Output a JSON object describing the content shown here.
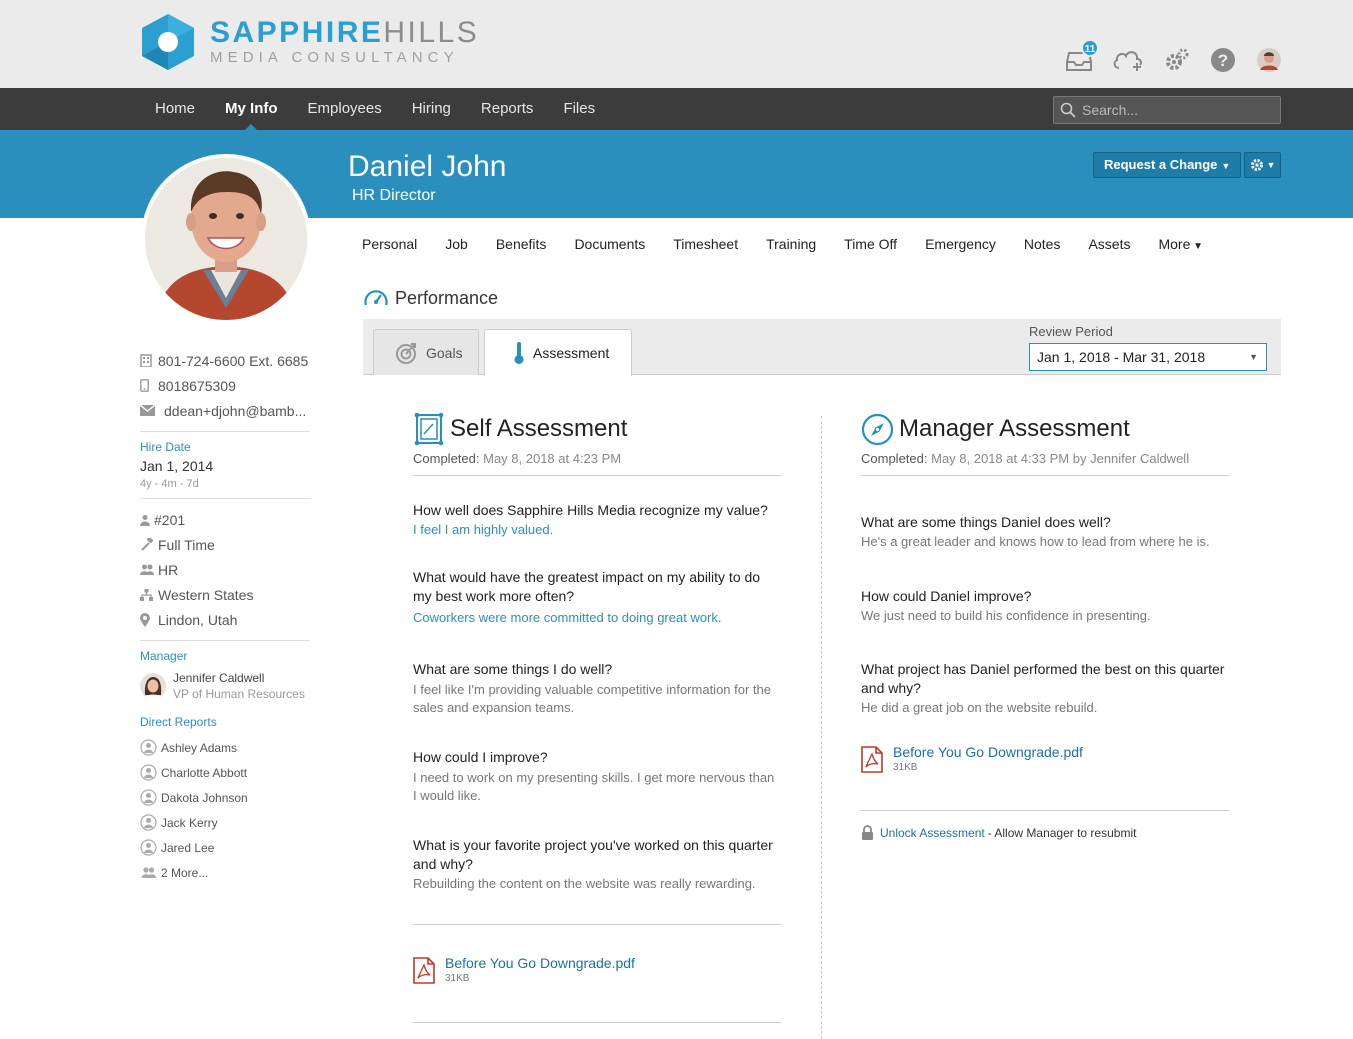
{
  "app": {
    "logo_word_1": "SAPPHIRE",
    "logo_word_2": "HILLS",
    "logo_sub": "MEDIA CONSULTANCY",
    "inbox_count": "11",
    "brand_color": "#2a8fbd"
  },
  "nav": {
    "items": [
      "Home",
      "My Info",
      "Employees",
      "Hiring",
      "Reports",
      "Files"
    ],
    "active": "My Info",
    "search_placeholder": "Search..."
  },
  "employee": {
    "name": "Daniel John",
    "title": "HR Director",
    "request_change_label": "Request a Change"
  },
  "sidebar": {
    "work_phone": "801-724-6600 Ext. 6685",
    "mobile_phone": "8018675309",
    "email": "ddean+djohn@bamb...",
    "hire_date_label": "Hire Date",
    "hire_date": "Jan 1, 2014",
    "tenure": "4y - 4m - 7d",
    "employee_number": "#201",
    "employment_status": "Full Time",
    "department": "HR",
    "division": "Western States",
    "location": "Lindon, Utah",
    "manager_label": "Manager",
    "manager_name": "Jennifer Caldwell",
    "manager_title": "VP of Human Resources",
    "direct_reports_label": "Direct Reports",
    "direct_reports": [
      "Ashley Adams",
      "Charlotte Abbott",
      "Dakota Johnson",
      "Jack Kerry",
      "Jared Lee"
    ],
    "more_reports": "2 More..."
  },
  "subtabs": [
    "Personal",
    "Job",
    "Benefits",
    "Documents",
    "Timesheet",
    "Training",
    "Time Off",
    "Emergency",
    "Notes",
    "Assets",
    "More"
  ],
  "performance": {
    "title": "Performance",
    "tab_goals": "Goals",
    "tab_assessment": "Assessment",
    "review_period_label": "Review Period",
    "review_period_value": "Jan 1, 2018 - Mar 31, 2018"
  },
  "self_assessment": {
    "title": "Self Assessment",
    "completed_label": "Completed:",
    "completed_value": "May 8, 2018 at 4:23 PM",
    "items": [
      {
        "q": "How well does Sapphire Hills Media recognize my value?",
        "a": "I feel I am highly valued."
      },
      {
        "q": "What would have the greatest impact on my ability to do my best work more often?",
        "a": "Coworkers were more committed to doing great work."
      },
      {
        "q": "What are some things I do well?",
        "a": "I feel like I'm providing valuable competitive information for the sales and expansion teams."
      },
      {
        "q": "How could I improve?",
        "a": "I need to work on my presenting skills. I get more nervous than I would like."
      },
      {
        "q": "What is your favorite project you've worked on this quarter and why?",
        "a": "Rebuilding the content on the website was really rewarding."
      }
    ],
    "file_name": "Before You Go Downgrade.pdf",
    "file_size": "31KB"
  },
  "manager_assessment": {
    "title": "Manager Assessment",
    "completed_label": "Completed:",
    "completed_value": "May 8, 2018 at 4:33 PM by Jennifer Caldwell",
    "items": [
      {
        "q": "What are some things Daniel does well?",
        "a": "He's a great leader and knows how to lead from where he is."
      },
      {
        "q": "How could Daniel improve?",
        "a": "We just need to build his confidence in presenting."
      },
      {
        "q": "What project has Daniel performed the best on this quarter and why?",
        "a": "He did a great job on the website rebuild."
      }
    ],
    "file_name": "Before You Go Downgrade.pdf",
    "file_size": "31KB",
    "unlock_link": "Unlock Assessment",
    "unlock_note": "- Allow Manager to resubmit"
  }
}
